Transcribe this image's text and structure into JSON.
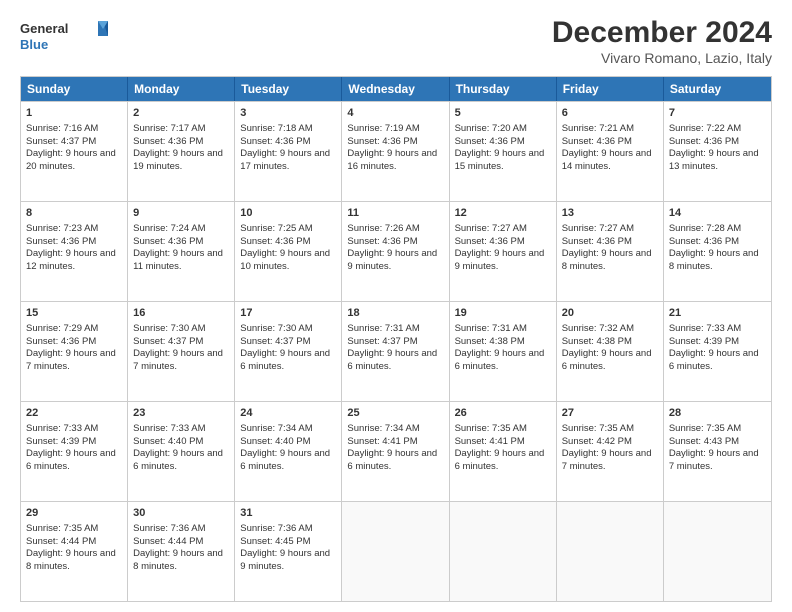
{
  "header": {
    "logo_line1": "General",
    "logo_line2": "Blue",
    "title": "December 2024",
    "subtitle": "Vivaro Romano, Lazio, Italy"
  },
  "days_of_week": [
    "Sunday",
    "Monday",
    "Tuesday",
    "Wednesday",
    "Thursday",
    "Friday",
    "Saturday"
  ],
  "weeks": [
    [
      {
        "day": "1",
        "sunrise": "7:16 AM",
        "sunset": "4:37 PM",
        "daylight": "9 hours and 20 minutes."
      },
      {
        "day": "2",
        "sunrise": "7:17 AM",
        "sunset": "4:36 PM",
        "daylight": "9 hours and 19 minutes."
      },
      {
        "day": "3",
        "sunrise": "7:18 AM",
        "sunset": "4:36 PM",
        "daylight": "9 hours and 17 minutes."
      },
      {
        "day": "4",
        "sunrise": "7:19 AM",
        "sunset": "4:36 PM",
        "daylight": "9 hours and 16 minutes."
      },
      {
        "day": "5",
        "sunrise": "7:20 AM",
        "sunset": "4:36 PM",
        "daylight": "9 hours and 15 minutes."
      },
      {
        "day": "6",
        "sunrise": "7:21 AM",
        "sunset": "4:36 PM",
        "daylight": "9 hours and 14 minutes."
      },
      {
        "day": "7",
        "sunrise": "7:22 AM",
        "sunset": "4:36 PM",
        "daylight": "9 hours and 13 minutes."
      }
    ],
    [
      {
        "day": "8",
        "sunrise": "7:23 AM",
        "sunset": "4:36 PM",
        "daylight": "9 hours and 12 minutes."
      },
      {
        "day": "9",
        "sunrise": "7:24 AM",
        "sunset": "4:36 PM",
        "daylight": "9 hours and 11 minutes."
      },
      {
        "day": "10",
        "sunrise": "7:25 AM",
        "sunset": "4:36 PM",
        "daylight": "9 hours and 10 minutes."
      },
      {
        "day": "11",
        "sunrise": "7:26 AM",
        "sunset": "4:36 PM",
        "daylight": "9 hours and 9 minutes."
      },
      {
        "day": "12",
        "sunrise": "7:27 AM",
        "sunset": "4:36 PM",
        "daylight": "9 hours and 9 minutes."
      },
      {
        "day": "13",
        "sunrise": "7:27 AM",
        "sunset": "4:36 PM",
        "daylight": "9 hours and 8 minutes."
      },
      {
        "day": "14",
        "sunrise": "7:28 AM",
        "sunset": "4:36 PM",
        "daylight": "9 hours and 8 minutes."
      }
    ],
    [
      {
        "day": "15",
        "sunrise": "7:29 AM",
        "sunset": "4:36 PM",
        "daylight": "9 hours and 7 minutes."
      },
      {
        "day": "16",
        "sunrise": "7:30 AM",
        "sunset": "4:37 PM",
        "daylight": "9 hours and 7 minutes."
      },
      {
        "day": "17",
        "sunrise": "7:30 AM",
        "sunset": "4:37 PM",
        "daylight": "9 hours and 6 minutes."
      },
      {
        "day": "18",
        "sunrise": "7:31 AM",
        "sunset": "4:37 PM",
        "daylight": "9 hours and 6 minutes."
      },
      {
        "day": "19",
        "sunrise": "7:31 AM",
        "sunset": "4:38 PM",
        "daylight": "9 hours and 6 minutes."
      },
      {
        "day": "20",
        "sunrise": "7:32 AM",
        "sunset": "4:38 PM",
        "daylight": "9 hours and 6 minutes."
      },
      {
        "day": "21",
        "sunrise": "7:33 AM",
        "sunset": "4:39 PM",
        "daylight": "9 hours and 6 minutes."
      }
    ],
    [
      {
        "day": "22",
        "sunrise": "7:33 AM",
        "sunset": "4:39 PM",
        "daylight": "9 hours and 6 minutes."
      },
      {
        "day": "23",
        "sunrise": "7:33 AM",
        "sunset": "4:40 PM",
        "daylight": "9 hours and 6 minutes."
      },
      {
        "day": "24",
        "sunrise": "7:34 AM",
        "sunset": "4:40 PM",
        "daylight": "9 hours and 6 minutes."
      },
      {
        "day": "25",
        "sunrise": "7:34 AM",
        "sunset": "4:41 PM",
        "daylight": "9 hours and 6 minutes."
      },
      {
        "day": "26",
        "sunrise": "7:35 AM",
        "sunset": "4:41 PM",
        "daylight": "9 hours and 6 minutes."
      },
      {
        "day": "27",
        "sunrise": "7:35 AM",
        "sunset": "4:42 PM",
        "daylight": "9 hours and 7 minutes."
      },
      {
        "day": "28",
        "sunrise": "7:35 AM",
        "sunset": "4:43 PM",
        "daylight": "9 hours and 7 minutes."
      }
    ],
    [
      {
        "day": "29",
        "sunrise": "7:35 AM",
        "sunset": "4:44 PM",
        "daylight": "9 hours and 8 minutes."
      },
      {
        "day": "30",
        "sunrise": "7:36 AM",
        "sunset": "4:44 PM",
        "daylight": "9 hours and 8 minutes."
      },
      {
        "day": "31",
        "sunrise": "7:36 AM",
        "sunset": "4:45 PM",
        "daylight": "9 hours and 9 minutes."
      },
      null,
      null,
      null,
      null
    ]
  ],
  "labels": {
    "sunrise": "Sunrise:",
    "sunset": "Sunset:",
    "daylight": "Daylight:"
  }
}
